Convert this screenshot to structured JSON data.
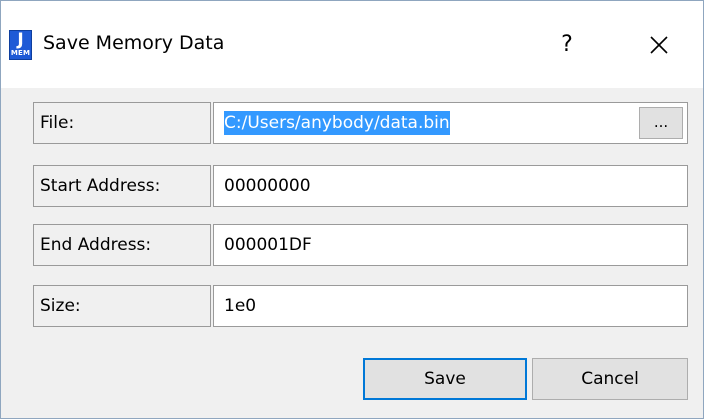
{
  "window": {
    "title": "Save Memory Data",
    "icon_letter": "J",
    "icon_sub": "MEM",
    "help_label": "?"
  },
  "form": {
    "file": {
      "label": "File:",
      "value": "C:/Users/anybody/data.bin",
      "browse_label": "..."
    },
    "start_address": {
      "label": "Start Address:",
      "value": "00000000"
    },
    "end_address": {
      "label": "End Address:",
      "value": "000001DF"
    },
    "size": {
      "label": "Size:",
      "value": "1e0"
    }
  },
  "buttons": {
    "save_label": "Save",
    "cancel_label": "Cancel"
  },
  "colors": {
    "selection": "#3399ff",
    "focus_border": "#0078d7",
    "icon_blue": "#1e5ad6"
  },
  "icons": {
    "app": "app-icon",
    "close": "close-icon"
  }
}
